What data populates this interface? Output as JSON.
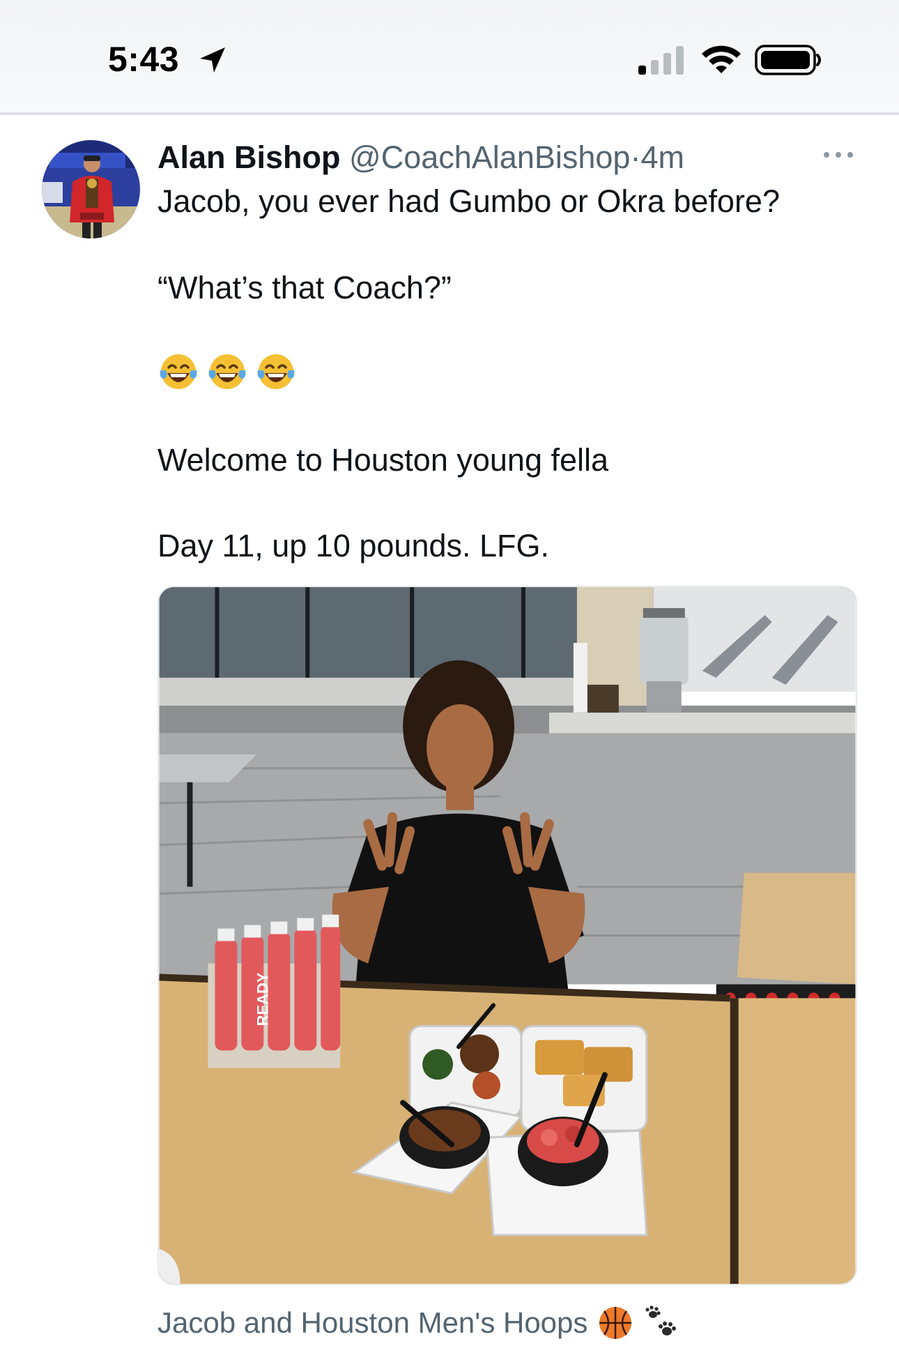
{
  "status_bar": {
    "time": "5:43"
  },
  "tweet": {
    "author": {
      "display_name": "Alan Bishop",
      "handle": "@CoachAlanBishop",
      "separator": "·",
      "timestamp": "4m"
    },
    "lines": [
      "Jacob, you ever had Gumbo or Okra before?",
      "“What’s that Coach?”",
      "Welcome to Houston young fella",
      "Day 11, up 10 pounds. LFG."
    ],
    "emojis": [
      "face-with-tears-of-joy-icon",
      "face-with-tears-of-joy-icon",
      "face-with-tears-of-joy-icon"
    ],
    "media": {
      "bottle_label": "READY"
    },
    "tagged_text": "Jacob and Houston Men's Hoops",
    "tagged_icons": [
      "basketball-icon",
      "paw-prints-icon"
    ]
  },
  "colors": {
    "text_primary": "#0f1419",
    "text_secondary": "#536471",
    "divider": "#dde1e5",
    "counter_red": "#d63a2c"
  }
}
